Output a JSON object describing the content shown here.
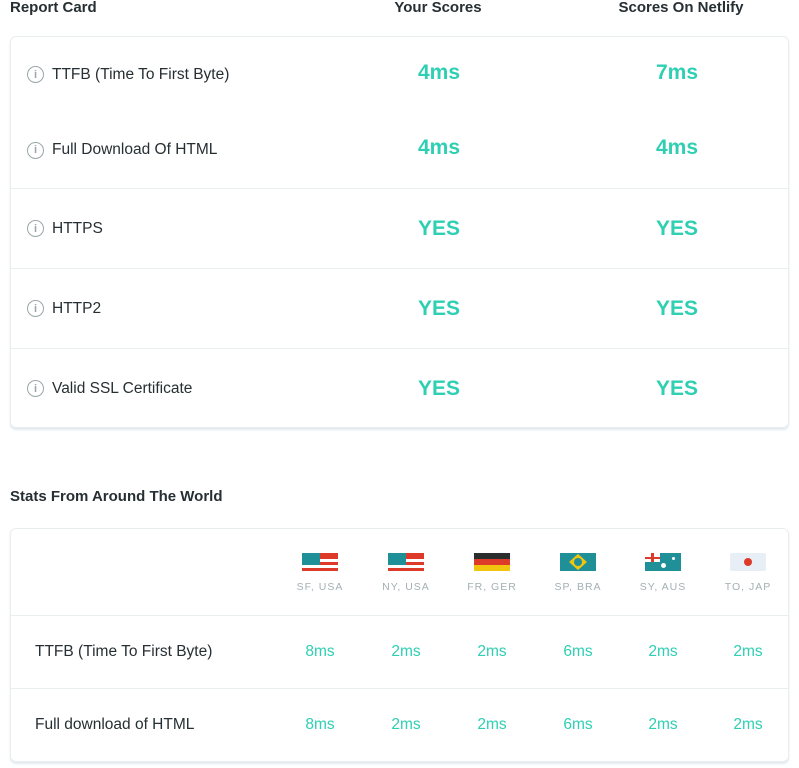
{
  "report": {
    "title": "Report Card",
    "col_yours": "Your Scores",
    "col_netlify": "Scores On Netlify",
    "rows": [
      {
        "label": "TTFB (Time To First Byte)",
        "yours": "4ms",
        "netlify": "7ms"
      },
      {
        "label": "Full Download Of HTML",
        "yours": "4ms",
        "netlify": "4ms"
      },
      {
        "label": "HTTPS",
        "yours": "YES",
        "netlify": "YES"
      },
      {
        "label": "HTTP2",
        "yours": "YES",
        "netlify": "YES"
      },
      {
        "label": "Valid SSL Certificate",
        "yours": "YES",
        "netlify": "YES"
      }
    ]
  },
  "stats": {
    "title": "Stats From Around The World",
    "locations": [
      {
        "city": "SF, USA",
        "flag": "usa"
      },
      {
        "city": "NY, USA",
        "flag": "usa"
      },
      {
        "city": "FR, GER",
        "flag": "germany"
      },
      {
        "city": "SP, BRA",
        "flag": "brazil"
      },
      {
        "city": "SY, AUS",
        "flag": "australia"
      },
      {
        "city": "TO, JAP",
        "flag": "japan"
      }
    ],
    "rows": [
      {
        "label": "TTFB (Time To First Byte)",
        "values": [
          "8ms",
          "2ms",
          "2ms",
          "6ms",
          "2ms",
          "2ms"
        ]
      },
      {
        "label": "Full download of HTML",
        "values": [
          "8ms",
          "2ms",
          "2ms",
          "6ms",
          "2ms",
          "2ms"
        ]
      }
    ]
  },
  "colors": {
    "accent": "#2ecfb3",
    "flag_teal": "#1f9098",
    "flag_red": "#dd3a2a"
  }
}
